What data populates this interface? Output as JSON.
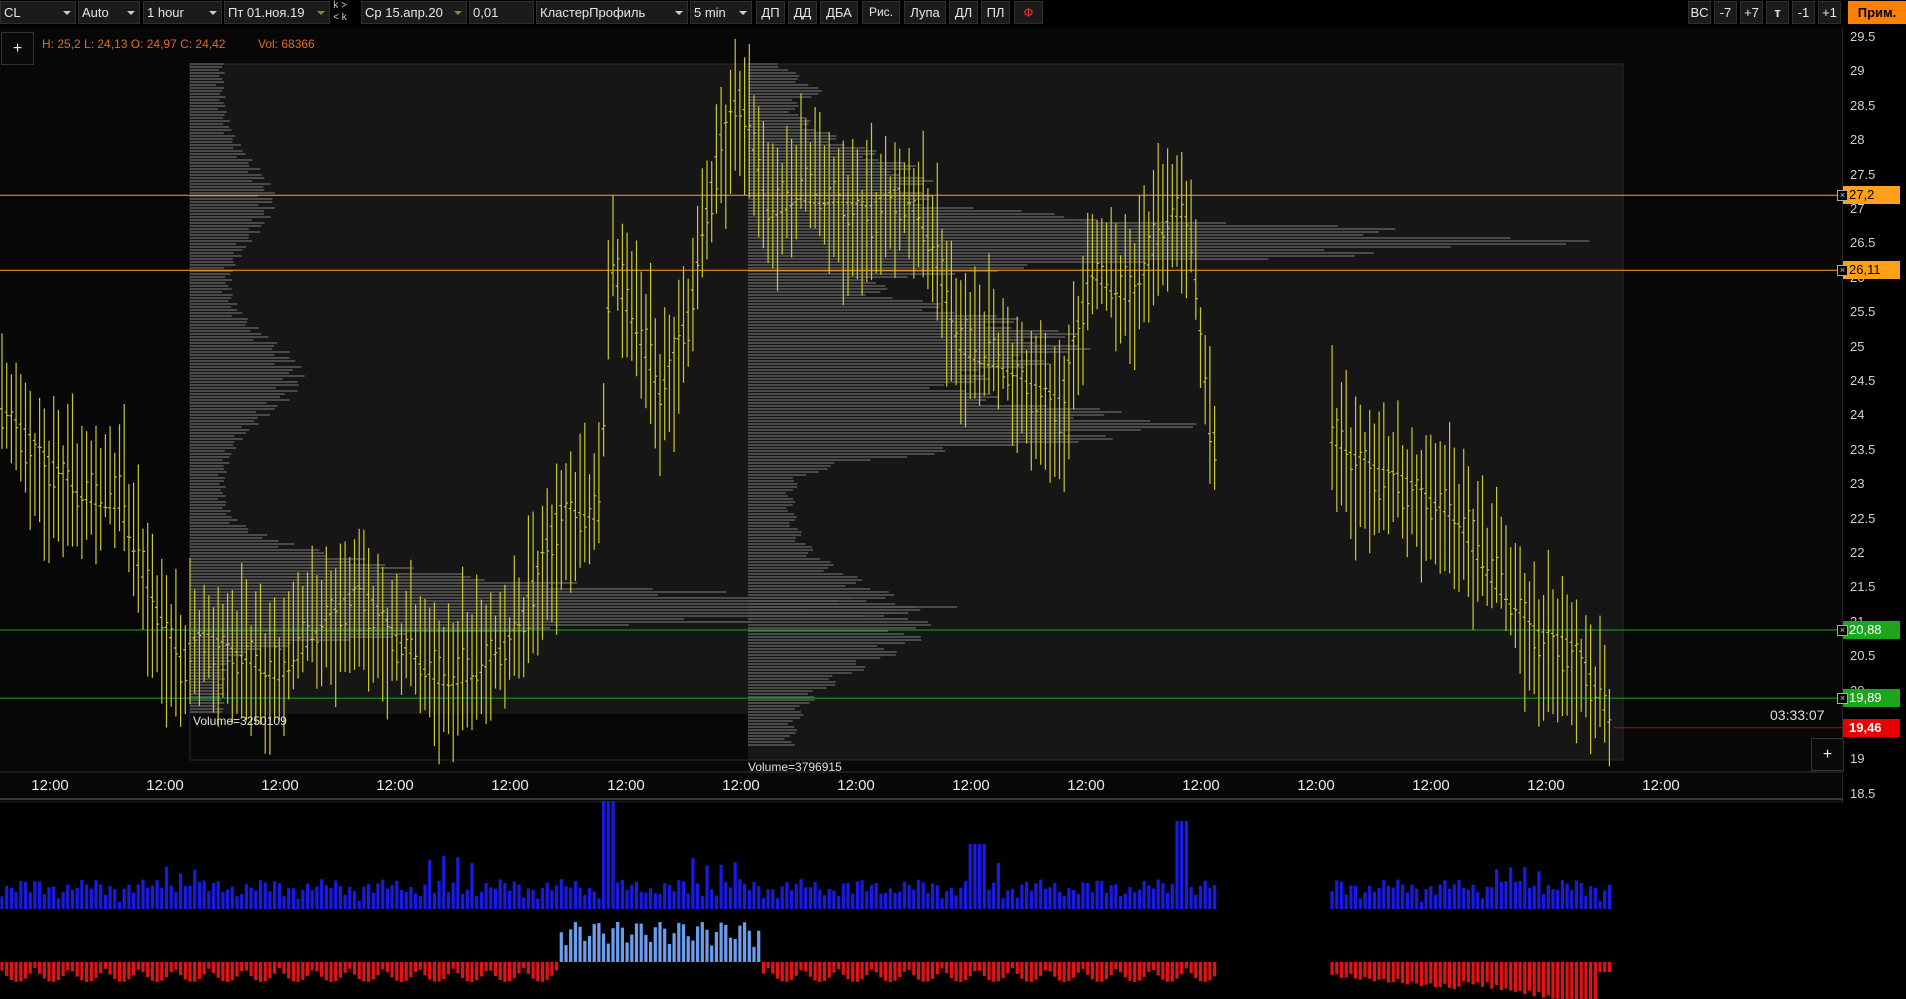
{
  "toolbar": {
    "symbol": "CL",
    "scale": "Auto",
    "timeframe": "1 hour",
    "date_from": "Пт 01.ноя.19",
    "date_to": "Ср 15.апр.20",
    "step": "0,01",
    "profile": "КластерПрофиль",
    "profile_tf": "5 min",
    "btn_dp": "ДП",
    "btn_dd": "ДД",
    "btn_dba": "ДБА",
    "btn_ris": "Рис.",
    "btn_lupa": "Лупа",
    "btn_dl": "ДЛ",
    "btn_pl": "ПЛ",
    "btn_f": "Ф",
    "btn_bc": "BC",
    "btn_m7": "-7",
    "btn_p7": "+7",
    "btn_t": "т",
    "btn_m1": "-1",
    "btn_p1": "+1",
    "btn_apply": "Прим.",
    "kk_top": "k >",
    "kk_bottom": "< k"
  },
  "info": {
    "ohlc": "H: 25,2 L: 24,13 O: 24,97 C: 24,42",
    "vol": "Vol: 68366",
    "plus": "+"
  },
  "price_axis": [
    "29.5",
    "29",
    "28.5",
    "28",
    "27.5",
    "27",
    "26.5",
    "26",
    "25.5",
    "25",
    "24.5",
    "24",
    "23.5",
    "23",
    "22.5",
    "22",
    "21.5",
    "21",
    "20.5",
    "20",
    "19.5",
    "19",
    "18.5"
  ],
  "levels": [
    {
      "value": "27,2",
      "color": "#ff9f1a",
      "text_color": "#000"
    },
    {
      "value": "26,11",
      "color": "#ff9f1a",
      "text_color": "#000"
    },
    {
      "value": "20,88",
      "color": "#1ea51e",
      "text_color": "#fff"
    },
    {
      "value": "19,89",
      "color": "#1ea51e",
      "text_color": "#fff"
    }
  ],
  "current_price": {
    "value": "19,46",
    "color": "#e60000"
  },
  "timer": "03:33:07",
  "time_labels": [
    "12:00",
    "12:00",
    "12:00",
    "12:00",
    "12:00",
    "12:00",
    "12:00",
    "12:00",
    "12:00",
    "12:00",
    "12:00",
    "12:00",
    "12:00",
    "12:00",
    "12:00"
  ],
  "profiles": [
    {
      "label": "Volume=3250109"
    },
    {
      "label": "Volume=3796915"
    }
  ],
  "colors": {
    "candle": "#c8c830",
    "profile": "#6a6a6a",
    "volume_bar": "#1a1ae6",
    "delta_pos": "#6c9ef0",
    "delta_neg": "#e01414",
    "level_orange": "#ff9f1a",
    "level_green": "#1ea51e"
  }
}
